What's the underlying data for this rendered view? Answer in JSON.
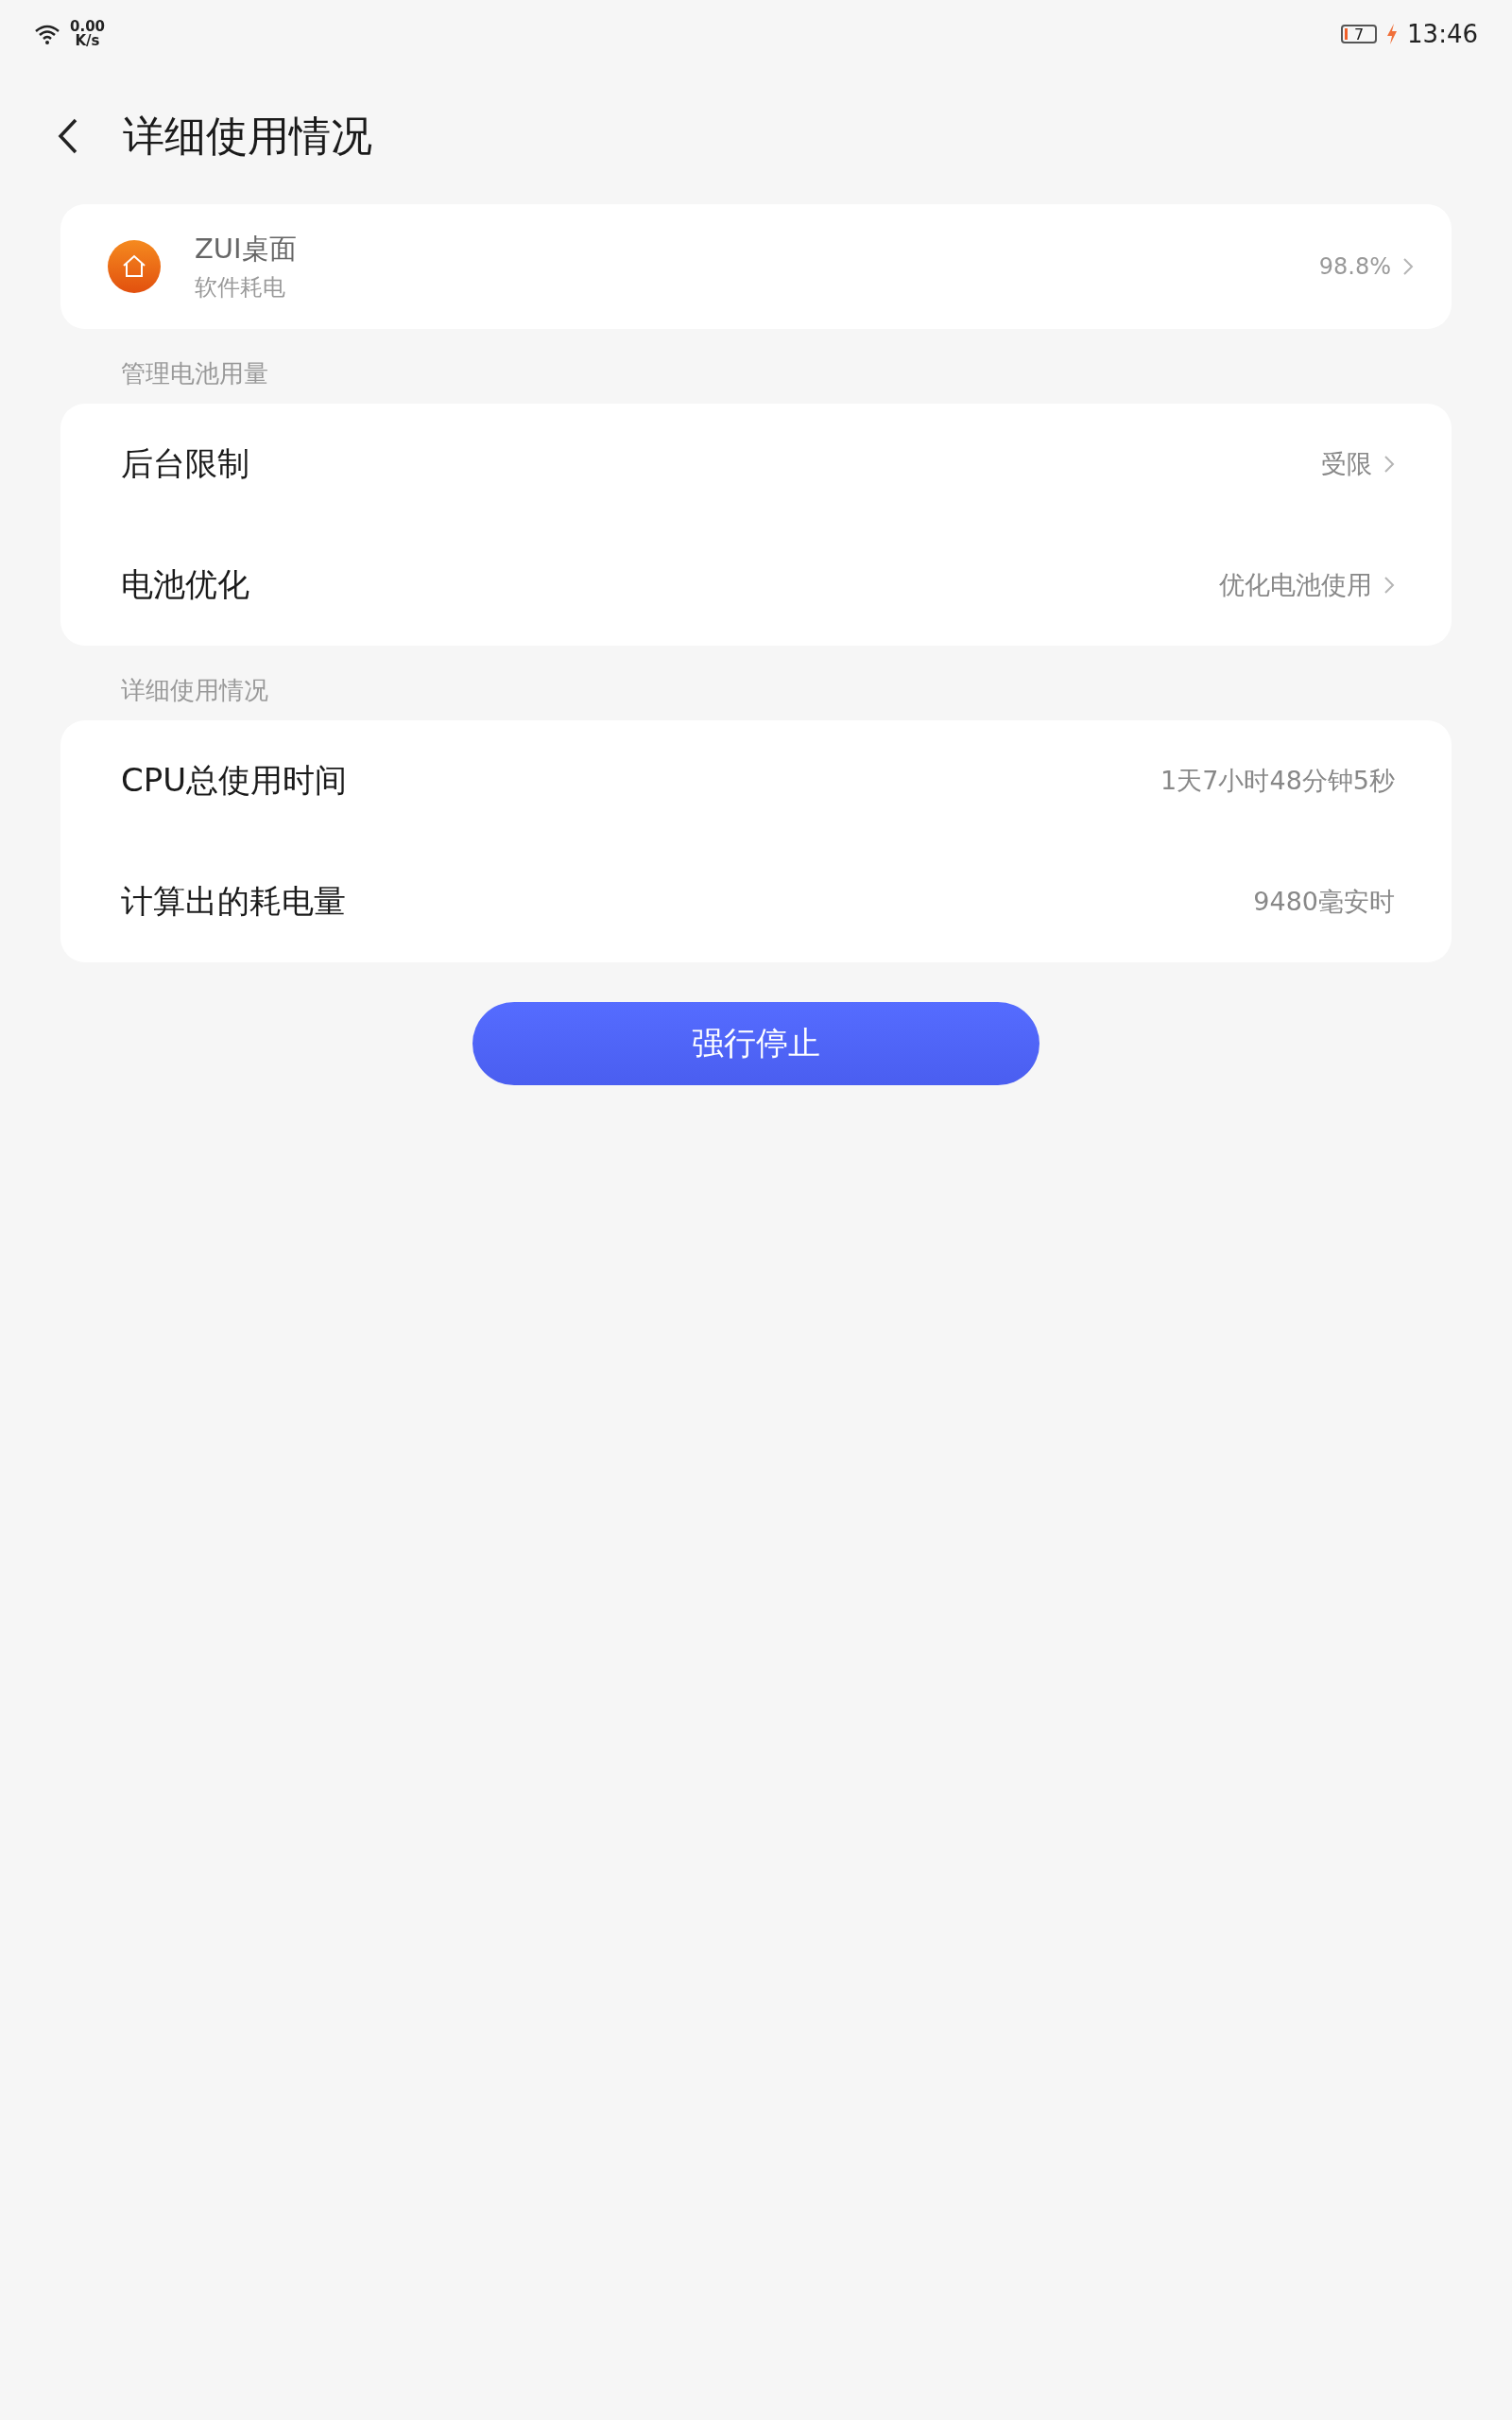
{
  "status_bar": {
    "net_speed": "0.00",
    "net_unit": "K/s",
    "battery": "7",
    "charging": true,
    "time": "13:46"
  },
  "header": {
    "title": "详细使用情况"
  },
  "app": {
    "name": "ZUI桌面",
    "subtitle": "软件耗电",
    "value": "98.8%"
  },
  "sections": [
    {
      "title": "管理电池用量",
      "rows": [
        {
          "label": "后台限制",
          "value": "受限",
          "kind": "link"
        },
        {
          "label": "电池优化",
          "value": "优化电池使用",
          "kind": "link"
        }
      ]
    },
    {
      "title": "详细使用情况",
      "rows": [
        {
          "label": "CPU总使用时间",
          "value": "1天7小时48分钟5秒",
          "kind": "info"
        },
        {
          "label": "计算出的耗电量",
          "value": "9480毫安时",
          "kind": "info"
        }
      ]
    }
  ],
  "button": {
    "label": "强行停止"
  }
}
